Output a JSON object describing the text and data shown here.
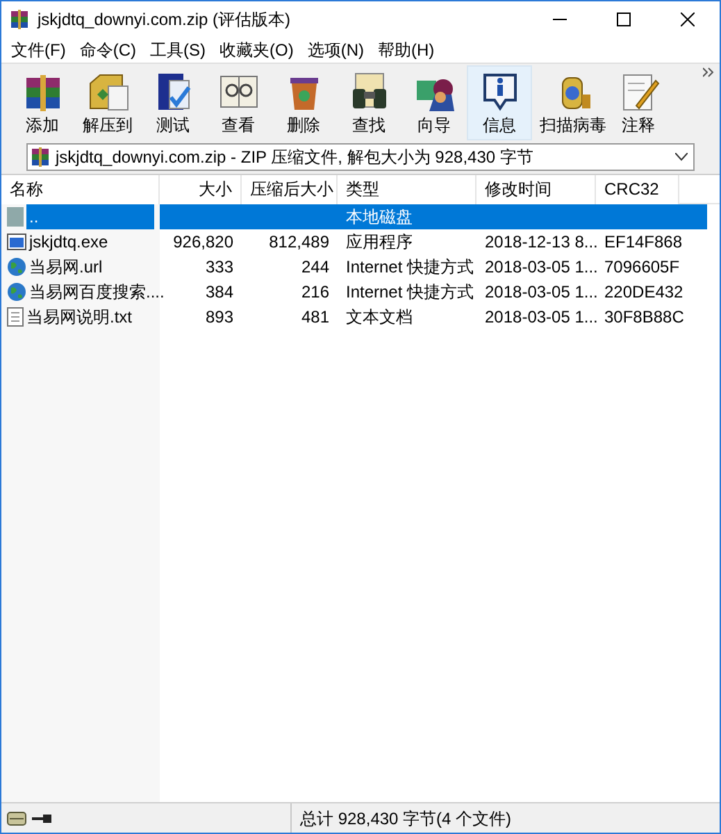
{
  "window": {
    "title": "jskjdtq_downyi.com.zip (评估版本)"
  },
  "menu": [
    "文件(F)",
    "命令(C)",
    "工具(S)",
    "收藏夹(O)",
    "选项(N)",
    "帮助(H)"
  ],
  "toolbar": [
    {
      "label": "添加",
      "selected": false
    },
    {
      "label": "解压到",
      "selected": false
    },
    {
      "label": "测试",
      "selected": false
    },
    {
      "label": "查看",
      "selected": false
    },
    {
      "label": "删除",
      "selected": false
    },
    {
      "label": "查找",
      "selected": false
    },
    {
      "label": "向导",
      "selected": false
    },
    {
      "label": "信息",
      "selected": true
    },
    {
      "label": "扫描病毒",
      "selected": false
    },
    {
      "label": "注释",
      "selected": false
    }
  ],
  "address": {
    "value": "jskjdtq_downyi.com.zip - ZIP 压缩文件, 解包大小为 928,430 字节"
  },
  "table": {
    "columns": [
      "名称",
      "大小",
      "压缩后大小",
      "类型",
      "修改时间",
      "CRC32"
    ],
    "rows": [
      {
        "kind": "folder",
        "selected": true,
        "cells": [
          "..",
          "",
          "",
          "本地磁盘",
          "",
          ""
        ]
      },
      {
        "kind": "exe",
        "selected": false,
        "cells": [
          "jskjdtq.exe",
          "926,820",
          "812,489",
          "应用程序",
          "2018-12-13 8...",
          "EF14F868"
        ]
      },
      {
        "kind": "url",
        "selected": false,
        "cells": [
          "当易网.url",
          "333",
          "244",
          "Internet 快捷方式",
          "2018-03-05 1...",
          "7096605F"
        ]
      },
      {
        "kind": "url",
        "selected": false,
        "cells": [
          "当易网百度搜索....",
          "384",
          "216",
          "Internet 快捷方式",
          "2018-03-05 1...",
          "220DE432"
        ]
      },
      {
        "kind": "txt",
        "selected": false,
        "cells": [
          "当易网说明.txt",
          "893",
          "481",
          "文本文档",
          "2018-03-05 1...",
          "30F8B88C"
        ]
      }
    ]
  },
  "status_bar": {
    "text": "总计 928,430 字节(4 个文件)"
  }
}
